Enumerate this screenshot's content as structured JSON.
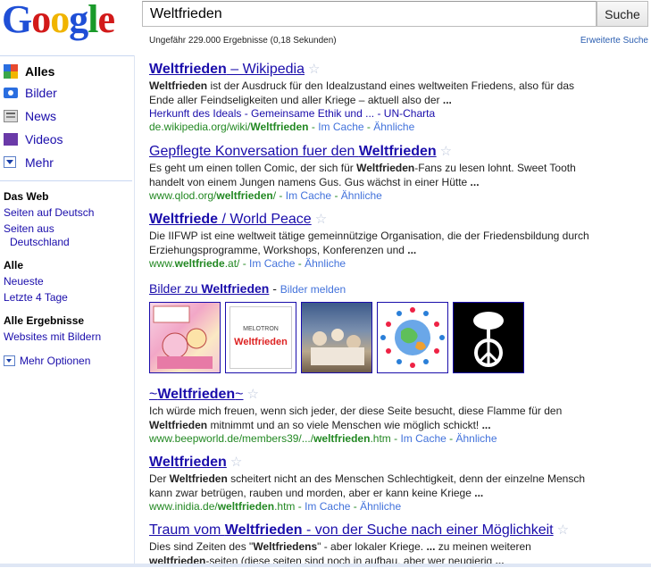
{
  "logo": {
    "letters": [
      "G",
      "o",
      "o",
      "g",
      "l",
      "e"
    ],
    "colors": [
      "#1f4fd6",
      "#d21a1a",
      "#f0b400",
      "#1f4fd6",
      "#1a9a2a",
      "#d21a1a"
    ]
  },
  "search": {
    "query": "Weltfrieden",
    "button": "Suche"
  },
  "stats": "Ungefähr 229.000 Ergebnisse (0,18 Sekunden)",
  "advanced": "Erweiterte Suche",
  "sidebar": {
    "types": [
      {
        "label": "Alles",
        "icon": "all-results-icon"
      },
      {
        "label": "Bilder",
        "icon": "camera-icon"
      },
      {
        "label": "News",
        "icon": "newspaper-icon"
      },
      {
        "label": "Videos",
        "icon": "film-icon"
      },
      {
        "label": "Mehr",
        "icon": "dropdown-icon"
      }
    ],
    "web_heading": "Das Web",
    "web_links": [
      "Seiten auf Deutsch",
      "Seiten aus",
      "Deutschland"
    ],
    "time_heading": "Alle",
    "time_links": [
      "Neueste",
      "Letzte 4 Tage"
    ],
    "result_heading": "Alle Ergebnisse",
    "result_links": [
      "Websites mit Bildern"
    ],
    "more_options": "Mehr Optionen"
  },
  "results": [
    {
      "title_pre": "",
      "title_bold": "Weltfrieden",
      "title_post": " – Wikipedia",
      "snippet": [
        [
          {
            "b": true,
            "t": "Weltfrieden"
          },
          {
            "b": false,
            "t": " ist der Ausdruck für den Idealzustand eines weltweiten Friedens, also für das"
          }
        ],
        [
          {
            "b": false,
            "t": "Ende aller Feindseligkeiten und aller Kriege – aktuell also der "
          },
          {
            "b": true,
            "t": "..."
          }
        ]
      ],
      "sublinks": "Herkunft des Ideals - Gemeinsame Ethik und ... - UN-Charta",
      "url_pre": "de.wikipedia.org/wiki/",
      "url_bold": "Weltfrieden",
      "url_post": "",
      "cache": "Im Cache",
      "similar": "Ähnliche"
    },
    {
      "title_pre": "Gepflegte Konversation fuer den ",
      "title_bold": "Weltfrieden",
      "title_post": "",
      "snippet": [
        [
          {
            "b": false,
            "t": "Es geht um einen tollen Comic, der sich für "
          },
          {
            "b": true,
            "t": "Weltfrieden"
          },
          {
            "b": false,
            "t": "-Fans zu lesen lohnt. Sweet Tooth"
          }
        ],
        [
          {
            "b": false,
            "t": "handelt von einem Jungen namens Gus. Gus wächst in einer Hütte "
          },
          {
            "b": true,
            "t": "..."
          }
        ]
      ],
      "sublinks": "",
      "url_pre": "www.qlod.org/",
      "url_bold": "weltfrieden",
      "url_post": "/",
      "cache": "Im Cache",
      "similar": "Ähnliche"
    },
    {
      "title_pre": "",
      "title_bold": "Weltfriede",
      "title_post": " / World Peace",
      "snippet": [
        [
          {
            "b": false,
            "t": "Die IIFWP ist eine weltweit tätige gemeinnützige Organisation, die der Friedensbildung durch"
          }
        ],
        [
          {
            "b": false,
            "t": "Erziehungsprogramme, Workshops, Konferenzen und "
          },
          {
            "b": true,
            "t": "..."
          }
        ]
      ],
      "sublinks": "",
      "url_pre": "www.",
      "url_bold": "weltfriede",
      "url_post": ".at/",
      "cache": "Im Cache",
      "similar": "Ähnliche"
    },
    {
      "title_pre": "~",
      "title_bold": "Weltfrieden",
      "title_post": "~",
      "snippet": [
        [
          {
            "b": false,
            "t": "Ich würde mich freuen, wenn sich jeder, der diese Seite besucht, diese Flamme für den"
          }
        ],
        [
          {
            "b": true,
            "t": "Weltfrieden"
          },
          {
            "b": false,
            "t": " mitnimmt und an so viele Menschen wie möglich schickt! "
          },
          {
            "b": true,
            "t": "..."
          }
        ]
      ],
      "sublinks": "",
      "url_pre": "www.beepworld.de/members39/.../",
      "url_bold": "weltfrieden",
      "url_post": ".htm",
      "cache": "Im Cache",
      "similar": "Ähnliche"
    },
    {
      "title_pre": "",
      "title_bold": "Weltfrieden",
      "title_post": "",
      "snippet": [
        [
          {
            "b": false,
            "t": "Der "
          },
          {
            "b": true,
            "t": "Weltfrieden"
          },
          {
            "b": false,
            "t": " scheitert nicht an des Menschen Schlechtigkeit, denn der einzelne Mensch"
          }
        ],
        [
          {
            "b": false,
            "t": "kann zwar betrügen, rauben und morden, aber er kann keine Kriege "
          },
          {
            "b": true,
            "t": "..."
          }
        ]
      ],
      "sublinks": "",
      "url_pre": "www.inidia.de/",
      "url_bold": "weltfrieden",
      "url_post": ".htm",
      "cache": "Im Cache",
      "similar": "Ähnliche"
    },
    {
      "title_pre": "Traum vom ",
      "title_bold": "Weltfrieden",
      "title_post": " - von der Suche nach einer Möglichkeit",
      "snippet": [
        [
          {
            "b": false,
            "t": "Dies sind Zeiten des \""
          },
          {
            "b": true,
            "t": "Weltfriedens"
          },
          {
            "b": false,
            "t": "\" - aber lokaler Kriege. "
          },
          {
            "b": true,
            "t": "..."
          },
          {
            "b": false,
            "t": " zu meinen weiteren"
          }
        ],
        [
          {
            "b": true,
            "t": "weltfrieden"
          },
          {
            "b": false,
            "t": "-seiten (diese seiten sind noch in aufbau, aber wer neugierig "
          },
          {
            "b": true,
            "t": "..."
          }
        ]
      ],
      "sublinks": "",
      "url_pre": "",
      "url_bold": "",
      "url_post": "",
      "cache": "",
      "similar": ""
    }
  ],
  "images_block": {
    "title_pre": "Bilder zu ",
    "title_bold": "Weltfrieden",
    "report": "Bilder melden",
    "thumb2_top": "MELOTRON",
    "thumb2_main": "Weltfrieden"
  }
}
